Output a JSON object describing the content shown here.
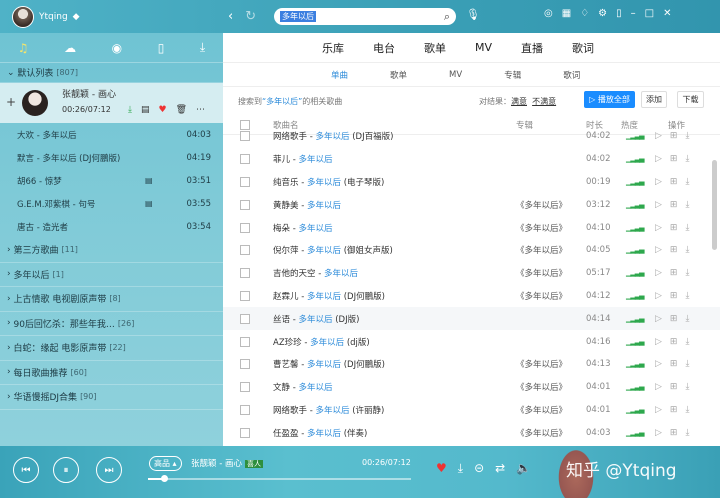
{
  "header": {
    "username": "Ytqing",
    "search_value": "多年以后"
  },
  "sidebar": {
    "default_list": {
      "label": "默认列表",
      "count": "[807]"
    },
    "now_playing": {
      "title": "张靓颖 - 画心",
      "time": "00:26/07:12"
    },
    "songs": [
      {
        "title": "大欢 - 多年以后",
        "dur": "04:03",
        "mv": false
      },
      {
        "title": "默言 - 多年以后 (DJ何鵬版)",
        "dur": "04:19",
        "mv": false
      },
      {
        "title": "胡66 - 惊梦",
        "dur": "03:51",
        "mv": true
      },
      {
        "title": "G.E.M.邓紫棋 - 句号",
        "dur": "03:55",
        "mv": true
      },
      {
        "title": "唐古 - 造光者",
        "dur": "03:54",
        "mv": false
      }
    ],
    "groups": [
      {
        "label": "第三方歌曲",
        "count": "[11]"
      },
      {
        "label": "多年以后",
        "count": "[1]"
      },
      {
        "label": "上古情歌 电视剧原声带",
        "count": "[8]"
      },
      {
        "label": "90后回忆杀：那些年我…",
        "count": "[26]"
      },
      {
        "label": "白蛇：缘起 电影原声带",
        "count": "[22]"
      },
      {
        "label": "每日歌曲推荐",
        "count": "[60]"
      },
      {
        "label": "华语慢摇DJ合集",
        "count": "[90]"
      }
    ]
  },
  "main": {
    "categories": [
      "乐库",
      "电台",
      "歌单",
      "MV",
      "直播",
      "歌词"
    ],
    "subtabs": [
      "单曲",
      "歌单",
      "MV",
      "专辑",
      "歌词"
    ],
    "hint_prefix": "搜索到",
    "hint_keyword": "“多年以后”",
    "hint_suffix": "的相关歌曲",
    "result_label": "对结果：",
    "satisfied": "满意",
    "unsatisfied": "不满意",
    "play_all": "播放全部",
    "add": "添加",
    "download": "下载",
    "columns": {
      "name": "歌曲名",
      "album": "专辑",
      "duration": "时长",
      "heat": "热度",
      "ops": "操作"
    },
    "rows": [
      {
        "artist": "网络歌手 - ",
        "song": "多年以后",
        "extra": " (DJ百福版)",
        "album": "",
        "dur": "04:02"
      },
      {
        "artist": "菲儿 - ",
        "song": "多年以后",
        "extra": "",
        "album": "",
        "dur": "04:02"
      },
      {
        "artist": "纯音乐 - ",
        "song": "多年以后",
        "extra": " (电子琴版)",
        "album": "",
        "dur": "00:19"
      },
      {
        "artist": "黄静美 - ",
        "song": "多年以后",
        "extra": "",
        "album": "《多年以后》",
        "dur": "03:12"
      },
      {
        "artist": "梅朵 - ",
        "song": "多年以后",
        "extra": "",
        "album": "《多年以后》",
        "dur": "04:10"
      },
      {
        "artist": "倪尔萍 - ",
        "song": "多年以后",
        "extra": " (御姐女声版)",
        "album": "《多年以后》",
        "dur": "04:05"
      },
      {
        "artist": "吉他的天空 - ",
        "song": "多年以后",
        "extra": "",
        "album": "《多年以后》",
        "dur": "05:17"
      },
      {
        "artist": "赵霖儿 - ",
        "song": "多年以后",
        "extra": " (DJ何鵬版)",
        "album": "《多年以后》",
        "dur": "04:12"
      },
      {
        "artist": "丝语 - ",
        "song": "多年以后",
        "extra": " (DJ版)",
        "album": "",
        "dur": "04:14"
      },
      {
        "artist": "AZ珍珍 - ",
        "song": "多年以后",
        "extra": " (dj版)",
        "album": "",
        "dur": "04:16"
      },
      {
        "artist": "曹艺馨 - ",
        "song": "多年以后",
        "extra": " (DJ何鵬版)",
        "album": "《多年以后》",
        "dur": "04:13"
      },
      {
        "artist": "文静 - ",
        "song": "多年以后",
        "extra": "",
        "album": "《多年以后》",
        "dur": "04:01"
      },
      {
        "artist": "网络歌手 - ",
        "song": "多年以后",
        "extra": " (许丽静)",
        "album": "《多年以后》",
        "dur": "04:01"
      },
      {
        "artist": "任盈盈 - ",
        "song": "多年以后",
        "extra": " (伴奏)",
        "album": "《多年以后》",
        "dur": "04:03"
      }
    ]
  },
  "player": {
    "quality": "高品",
    "title": "张靓颖 - 画心",
    "tag": "喜人",
    "time": "00:26/07:12",
    "progress": 0.06,
    "watermark": "知乎 @Ytqing"
  }
}
